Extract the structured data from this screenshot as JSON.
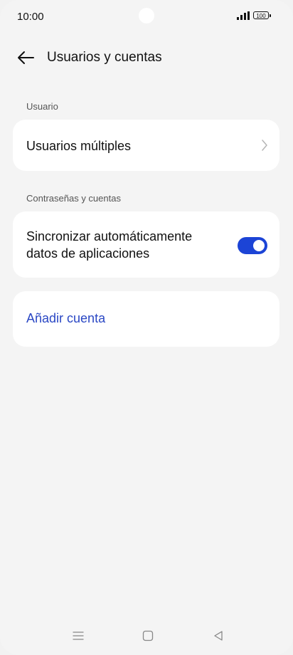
{
  "status_bar": {
    "time": "10:00",
    "battery": "100",
    "icons": [
      "camera-cutout",
      "signal-icon",
      "battery-icon"
    ]
  },
  "header": {
    "title": "Usuarios y cuentas",
    "back_icon": "arrow-left-icon"
  },
  "sections": {
    "users": {
      "label": "Usuario",
      "item_label": "Usuarios múltiples",
      "item_icon": "chevron-right-icon"
    },
    "accounts": {
      "label": "Contraseñas y cuentas",
      "sync_line1": "Sincronizar automáticamente",
      "sync_line2": "datos de aplicaciones",
      "sync_enabled": true
    }
  },
  "add_account": {
    "label": "Añadir cuenta"
  },
  "nav_bar": {
    "icons": [
      "menu-icon",
      "home-icon",
      "back-triangle-icon"
    ]
  },
  "colors": {
    "background": "#f4f4f4",
    "card": "#ffffff",
    "accent": "#1c44d6",
    "link": "#2a47c4"
  }
}
